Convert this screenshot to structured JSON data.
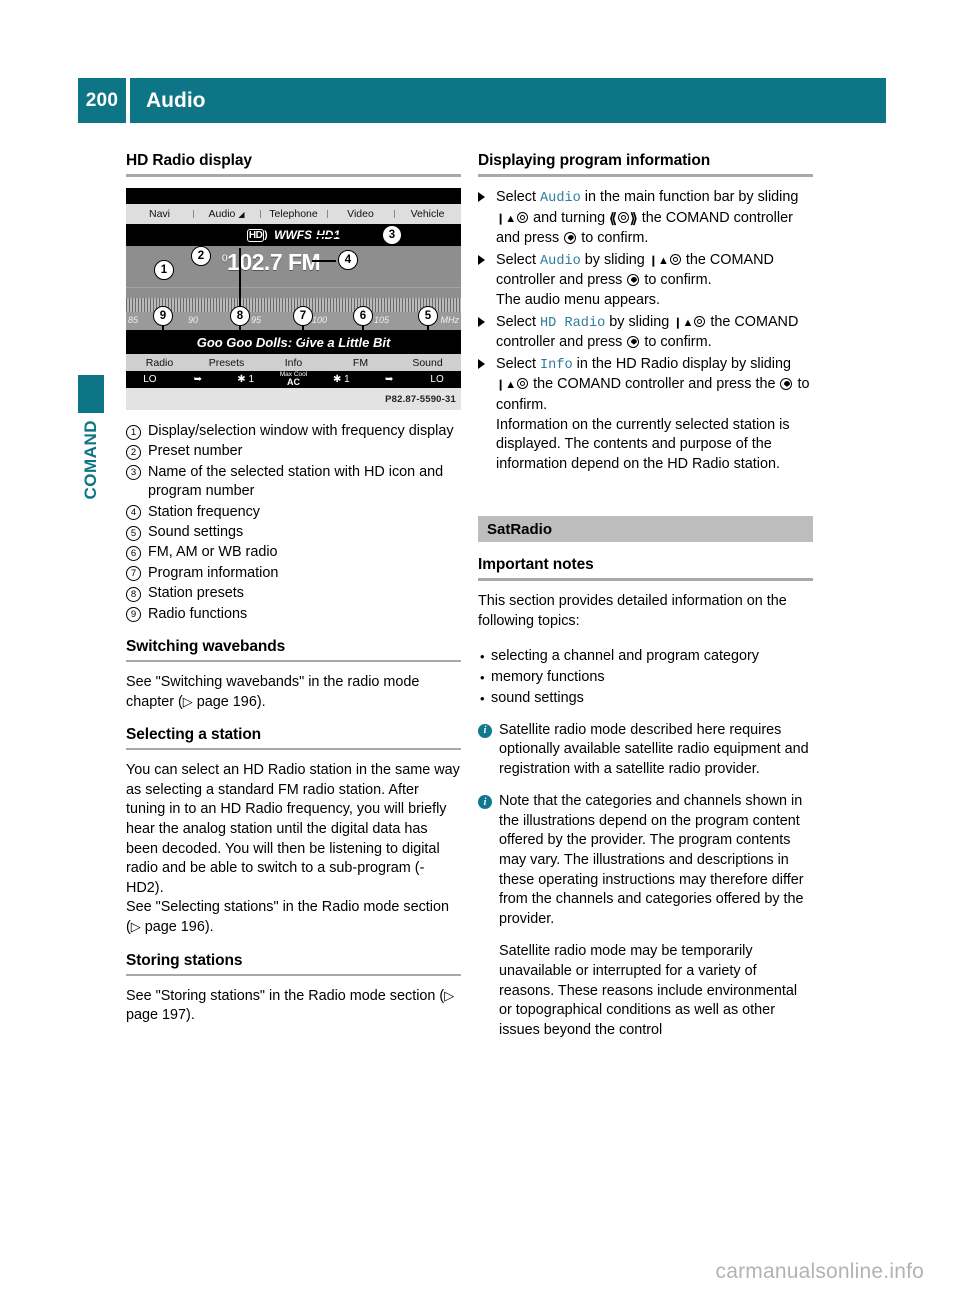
{
  "header": {
    "page_number": "200",
    "title": "Audio"
  },
  "side_tab": {
    "label": "COMAND"
  },
  "left": {
    "section_title": "HD Radio display",
    "illustration": {
      "caption_id": "P82.87-5590-31",
      "menu_bar": [
        "Navi",
        "Audio",
        "Telephone",
        "Video",
        "Vehicle"
      ],
      "station_name": "WWFS-HD1",
      "hd_icon": "hd-logo-icon",
      "preset_number": "0",
      "frequency": "102.7 FM",
      "scale_labels": [
        "85",
        "90",
        "95",
        "100",
        "105",
        "MHz"
      ],
      "track_text": "Goo Goo Dolls: Give a Little Bit",
      "function_bar": [
        "Radio",
        "Presets",
        "Info",
        "FM",
        "Sound"
      ],
      "climate_bar": {
        "left_temp": "LO",
        "right_temp": "LO",
        "left_fan": "1",
        "right_fan": "1",
        "ac_top": "Max Cool",
        "ac_bottom": "AC"
      },
      "callouts": [
        "1",
        "2",
        "3",
        "4",
        "5",
        "6",
        "7",
        "8",
        "9"
      ]
    },
    "legend": [
      {
        "num": "1",
        "text": "Display/selection window with frequency display"
      },
      {
        "num": "2",
        "text": "Preset number"
      },
      {
        "num": "3",
        "text": "Name of the selected station with HD icon and program number"
      },
      {
        "num": "4",
        "text": "Station frequency"
      },
      {
        "num": "5",
        "text": "Sound settings"
      },
      {
        "num": "6",
        "text": "FM, AM or WB radio"
      },
      {
        "num": "7",
        "text": "Program information"
      },
      {
        "num": "8",
        "text": "Station presets"
      },
      {
        "num": "9",
        "text": "Radio functions"
      }
    ],
    "switching": {
      "heading": "Switching wavebands",
      "body_a": "See \"Switching wavebands\" in the radio mode chapter (",
      "page_ref": "page 196",
      "body_b": ")."
    },
    "selecting": {
      "heading": "Selecting a station",
      "para1": "You can select an HD Radio station in the same way as selecting a standard FM radio station. After tuning in to an HD Radio frequency, you will briefly hear the analog station until the digital data has been decoded. You will then be listening to digital radio and be able to switch to a sub-program (-HD2).",
      "para2_a": "See \"Selecting stations\" in the Radio mode section (",
      "page_ref": "page 196",
      "para2_b": ")."
    },
    "storing": {
      "heading": "Storing stations",
      "body_a": "See \"Storing stations\" in the Radio mode section (",
      "page_ref": "page 197",
      "body_b": ")."
    }
  },
  "right": {
    "section_title": "Displaying program information",
    "steps": [
      {
        "p1": "Select ",
        "link": "Audio",
        "p2": " in the main function bar by sliding ",
        "p3": " and turning ",
        "p4": " the COMAND controller and press ",
        "p5": " to confirm.",
        "sub": ""
      },
      {
        "p1": "Select ",
        "link": "Audio",
        "p2": " by sliding ",
        "p3": " the COMAND controller and press ",
        "p5": " to confirm.",
        "sub": "The audio menu appears."
      },
      {
        "p1": "Select ",
        "link": "HD Radio",
        "p2": " by sliding ",
        "p3": " the COMAND controller and press ",
        "p5": " to confirm.",
        "sub": ""
      },
      {
        "p1": "Select ",
        "link": "Info",
        "p2": " in the HD Radio display by sliding ",
        "p3": " the COMAND controller and press the ",
        "p5": " to confirm.",
        "sub": "Information on the currently selected station is displayed. The contents and purpose of the information depend on the HD Radio station."
      }
    ],
    "band_heading": "SatRadio",
    "notes_heading": "Important notes",
    "intro": "This section provides detailed information on the following topics:",
    "topics": [
      "selecting a channel and program category",
      "memory functions",
      "sound settings"
    ],
    "info_notes": [
      "Satellite radio mode described here requires optionally available satellite radio equipment and registration with a satellite radio provider.",
      "Note that the categories and channels shown in the illustrations depend on the program content offered by the provider. The program contents may vary. The illustrations and descriptions in these operating instructions may therefore differ from the channels and categories offered by the provider."
    ],
    "closing_para": "Satellite radio mode may be temporarily unavailable or interrupted for a variety of reasons. These reasons include environmental or topographical conditions as well as other issues beyond the control"
  },
  "watermark": "carmanualsonline.info",
  "colors": {
    "brand_teal": "#0d7585",
    "link_blue": "#2c7d9b",
    "band_gray": "#bdbdbd"
  }
}
